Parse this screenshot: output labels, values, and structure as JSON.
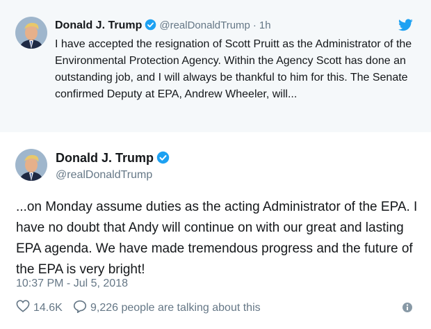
{
  "parent_tweet": {
    "display_name": "Donald J. Trump",
    "handle": "@realDonaldTrump",
    "separator": "·",
    "time": "1h",
    "text": "I have accepted the resignation of Scott Pruitt as the Administrator of the Environmental Protection Agency. Within the Agency Scott has done an outstanding job, and I will always be thankful to him for this. The Senate confirmed Deputy at EPA, Andrew Wheeler, will..."
  },
  "main_tweet": {
    "display_name": "Donald J. Trump",
    "handle": "@realDonaldTrump",
    "text": "...on Monday assume duties as the acting Administrator of the EPA. I have no doubt that Andy will continue on with our great and lasting EPA agenda. We have made tremendous progress and the future of the EPA is very bright!",
    "timestamp": "10:37 PM - Jul 5, 2018",
    "likes": "14.6K",
    "talking": "9,226 people are talking about this"
  },
  "icons": {
    "verified": "verified-badge-icon",
    "bird": "twitter-bird-icon",
    "like": "heart-icon",
    "reply": "reply-bubble-icon",
    "info": "info-icon"
  },
  "colors": {
    "accent": "#1da1f2",
    "muted": "#657786",
    "text": "#14171a",
    "parent_bg": "#f5f8fa"
  }
}
